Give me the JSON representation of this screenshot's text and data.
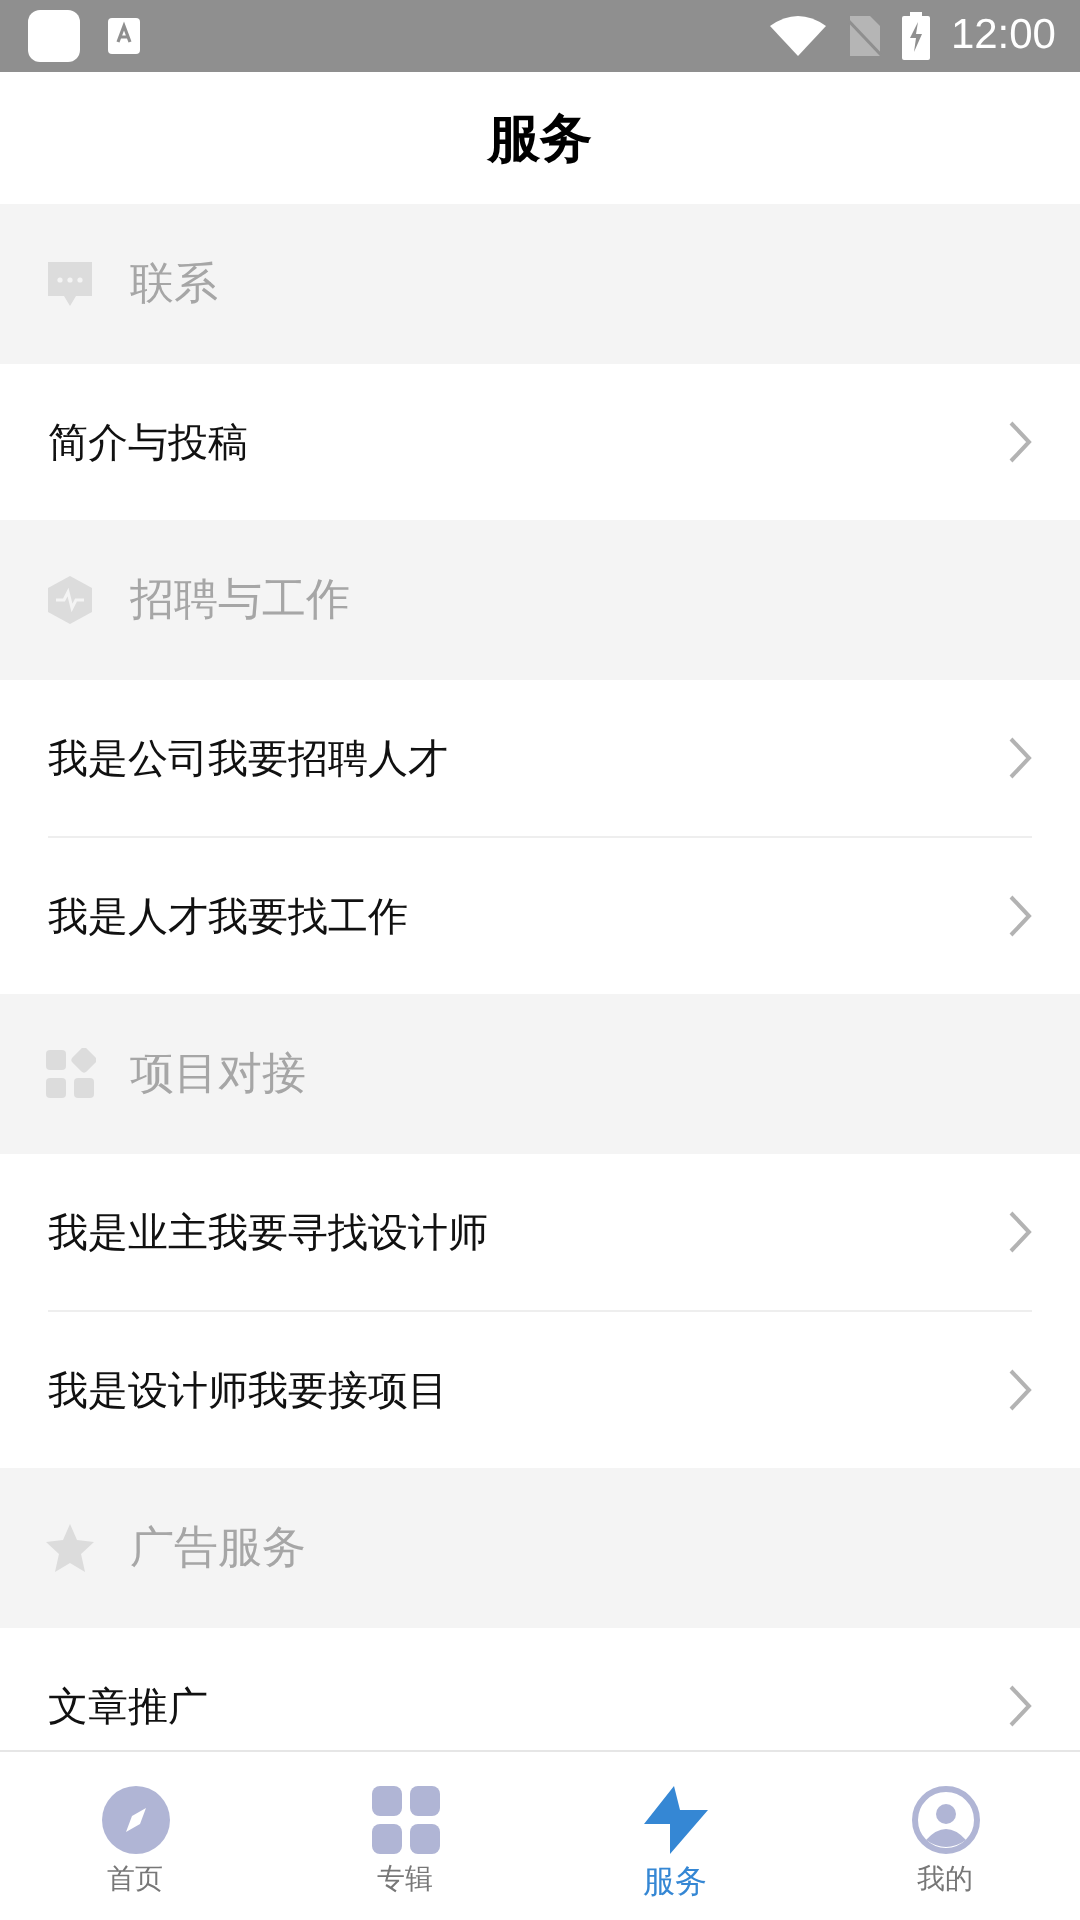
{
  "status_bar": {
    "time": "12:00"
  },
  "header": {
    "title": "服务"
  },
  "sections": [
    {
      "title": "联系",
      "kind": "chat",
      "items": [
        "简介与投稿"
      ]
    },
    {
      "title": "招聘与工作",
      "kind": "pulse",
      "items": [
        "我是公司我要招聘人才",
        "我是人才我要找工作"
      ]
    },
    {
      "title": "项目对接",
      "kind": "blocks",
      "items": [
        "我是业主我要寻找设计师",
        "我是设计师我要接项目"
      ]
    },
    {
      "title": "广告服务",
      "kind": "star",
      "items": [
        "文章推广"
      ]
    }
  ],
  "tab_bar": [
    {
      "label": "首页",
      "kind": "compass",
      "selected": false
    },
    {
      "label": "专辑",
      "kind": "grid",
      "selected": false
    },
    {
      "label": "服务",
      "kind": "bolt",
      "selected": true
    },
    {
      "label": "我的",
      "kind": "user",
      "selected": false
    }
  ]
}
